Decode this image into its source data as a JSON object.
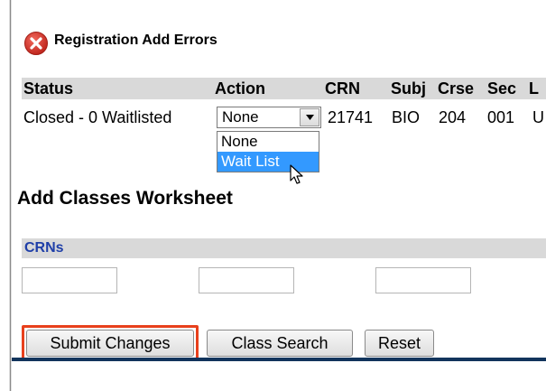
{
  "error": {
    "icon": "error-x-circle-icon",
    "title": "Registration Add Errors",
    "icon_color": "#d9342b"
  },
  "table": {
    "headers": [
      "Status",
      "Action",
      "CRN",
      "Subj",
      "Crse",
      "Sec",
      "L"
    ],
    "row": {
      "status": "Closed - 0 Waitlisted",
      "action_selected": "None",
      "crn": "21741",
      "subj": "BIO",
      "crse": "204",
      "sec": "001",
      "last": "U"
    },
    "action_options": [
      "None",
      "Wait List"
    ],
    "highlighted_option": "Wait List"
  },
  "worksheet": {
    "title": "Add Classes Worksheet",
    "crn_label": "CRNs",
    "crn_inputs": [
      "",
      "",
      ""
    ]
  },
  "buttons": {
    "submit": "Submit Changes",
    "class_search": "Class Search",
    "reset": "Reset"
  },
  "colors": {
    "header_bg": "#d9d9d9",
    "crn_label": "#1f3fa8",
    "highlight_border": "#e8401c",
    "selected_option_bg": "#3399ff",
    "bottom_rule": "#12345c"
  }
}
